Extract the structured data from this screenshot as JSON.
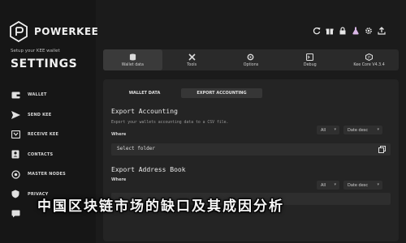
{
  "brand": {
    "name": "POWERKEE"
  },
  "sidebar": {
    "setup_text": "Setup your KEE wallet",
    "title": "SETTINGS",
    "items": [
      {
        "label": "WALLET",
        "icon": "wallet-icon"
      },
      {
        "label": "SEND KEE",
        "icon": "send-icon"
      },
      {
        "label": "RECEIVE KEE",
        "icon": "receive-icon"
      },
      {
        "label": "CONTACTS",
        "icon": "contacts-icon"
      },
      {
        "label": "MASTER NODES",
        "icon": "master-nodes-icon"
      },
      {
        "label": "PRIVACY",
        "icon": "privacy-icon"
      },
      {
        "label": "",
        "icon": "chat-icon"
      }
    ]
  },
  "topbar": {
    "icons": [
      "refresh-icon",
      "gift-icon",
      "lock-icon",
      "potion-icon",
      "settings-icon",
      "upload-icon"
    ]
  },
  "tabs": [
    {
      "label": "Wallet data",
      "icon": "database-icon",
      "active": true
    },
    {
      "label": "Tools",
      "icon": "tools-icon",
      "active": false
    },
    {
      "label": "Options",
      "icon": "options-icon",
      "active": false
    },
    {
      "label": "Debug",
      "icon": "debug-icon",
      "active": false
    },
    {
      "label": "Kee Core V4.3.4",
      "icon": "kee-core-icon",
      "active": false
    }
  ],
  "subtabs": [
    {
      "label": "WALLET DATA",
      "active": false
    },
    {
      "label": "EXPORT ACCOUNTING",
      "active": true
    }
  ],
  "export_accounting": {
    "title": "Export Accounting",
    "description": "Export your wallets accounting data to a CSV file.",
    "where_label": "Where",
    "filter_value": "All",
    "sort_value": "Date desc",
    "folder_placeholder": "Select folder"
  },
  "export_address_book": {
    "title": "Export Address Book",
    "where_label": "Where",
    "filter_value": "All",
    "sort_value": "Date desc"
  },
  "caption": "中国区块链市场的缺口及其成因分析"
}
